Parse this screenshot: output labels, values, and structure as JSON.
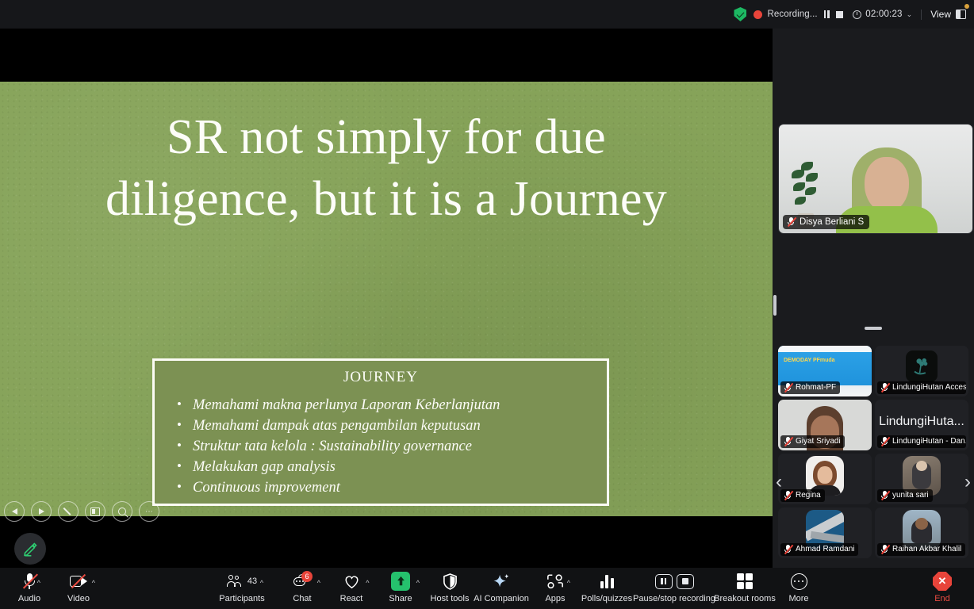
{
  "topbar": {
    "encryption_icon": "shield-check-icon",
    "recording_label": "Recording...",
    "pause_icon": "pause-icon",
    "stop_icon": "stop-icon",
    "clock_icon": "clock-icon",
    "timer": "02:00:23",
    "timer_caret": "⌄",
    "view_label": "View",
    "view_icon": "layout-icon"
  },
  "slide": {
    "title": "SR not simply for due diligence, but it is a Journey",
    "box_heading": "JOURNEY",
    "bullets": [
      "Memahami makna perlunya Laporan Keberlanjutan",
      "Memahami dampak atas pengambilan keputusan",
      "Struktur tata kelola : Sustainability governance",
      "Melakukan gap analysis",
      "Continuous improvement"
    ],
    "background_color": "#86a359",
    "box_color": "#7c9153",
    "text_color": "#fdfdf8"
  },
  "slide_nav": {
    "prev": "previous-slide-icon",
    "next": "next-slide-icon",
    "pen": "pen-icon",
    "layout": "layout-icon",
    "zoom": "magnifier-icon",
    "more": "more-icon"
  },
  "annotate_button": {
    "icon": "pencil-icon",
    "color": "#2ecc71"
  },
  "right_panel": {
    "active_speaker": {
      "name": "Disya Berliani S",
      "mic_icon": "mic-off-icon"
    },
    "thumbnails": [
      {
        "name": "Rohmat-PF",
        "mic_icon": "mic-off-icon",
        "type": "screenshare",
        "slide_title": "DEMODAY PFmuda"
      },
      {
        "name": "LindungiHutan Access",
        "mic_icon": "mic-off-icon",
        "type": "avatar"
      },
      {
        "name": "Giyat Sriyadi",
        "mic_icon": "mic-off-icon",
        "type": "video"
      },
      {
        "name": "LindungiHutan - Dan...",
        "mic_icon": "mic-off-icon",
        "type": "name-only",
        "display_name": "LindungiHuta..."
      },
      {
        "name": "Regina",
        "mic_icon": "mic-off-icon",
        "type": "video"
      },
      {
        "name": "yunita sari",
        "mic_icon": "mic-off-icon",
        "type": "video"
      },
      {
        "name": "Ahmad Ramdani",
        "mic_icon": "mic-off-icon",
        "type": "video"
      },
      {
        "name": "Raihan Akbar Khalil",
        "mic_icon": "mic-off-icon",
        "type": "video"
      }
    ],
    "carousel_prev": "‹",
    "carousel_next": "›"
  },
  "toolbar": {
    "items": [
      {
        "label": "Audio",
        "icon": "microphone-off-icon",
        "caret": true
      },
      {
        "label": "Video",
        "icon": "camera-off-icon",
        "caret": true
      },
      {
        "label": "Participants",
        "icon": "participants-icon",
        "count": "43",
        "caret": true
      },
      {
        "label": "Chat",
        "icon": "chat-icon",
        "badge": "6",
        "caret": true
      },
      {
        "label": "React",
        "icon": "heart-icon",
        "caret": true
      },
      {
        "label": "Share",
        "icon": "share-screen-icon",
        "caret": true
      },
      {
        "label": "Host tools",
        "icon": "shield-icon",
        "caret": false
      },
      {
        "label": "AI Companion",
        "icon": "sparkle-icon",
        "caret": false
      },
      {
        "label": "Apps",
        "icon": "apps-icon",
        "caret": true
      },
      {
        "label": "Polls/quizzes",
        "icon": "bar-chart-icon",
        "caret": false
      },
      {
        "label": "Pause/stop recording",
        "icon": "pause-stop-recording-icon",
        "caret": false
      },
      {
        "label": "Breakout rooms",
        "icon": "grid-icon",
        "caret": false
      },
      {
        "label": "More",
        "icon": "ellipsis-icon",
        "caret": false
      }
    ],
    "end_label": "End",
    "end_icon": "end-call-icon",
    "end_color": "#ea4b41"
  }
}
